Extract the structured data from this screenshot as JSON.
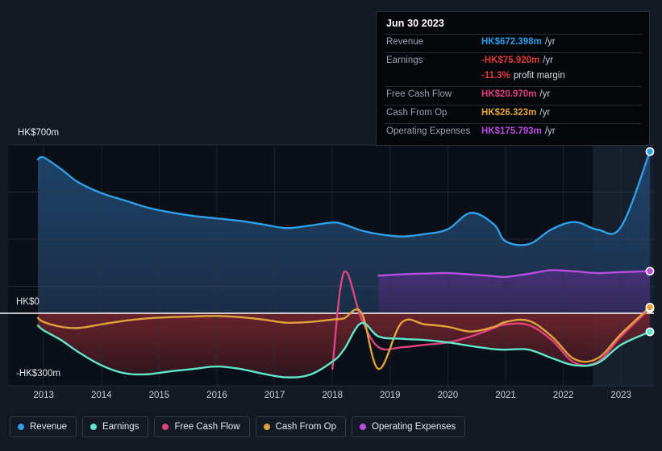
{
  "tooltip": {
    "date": "Jun 30 2023",
    "rows": [
      {
        "label": "Revenue",
        "value": "HK$672.398m",
        "unit": "/yr",
        "color": "#2f9fe8"
      },
      {
        "label": "Earnings",
        "value": "-HK$75.920m",
        "unit": "/yr",
        "color": "#e03c3c"
      },
      {
        "label": "",
        "value": "-11.3%",
        "unit": "profit margin",
        "color": "#e03c3c"
      },
      {
        "label": "Free Cash Flow",
        "value": "HK$20.970m",
        "unit": "/yr",
        "color": "#e0427d"
      },
      {
        "label": "Cash From Op",
        "value": "HK$26.323m",
        "unit": "/yr",
        "color": "#e0a33c"
      },
      {
        "label": "Operating Expenses",
        "value": "HK$175.793m",
        "unit": "/yr",
        "color": "#b84de0"
      }
    ]
  },
  "legend": {
    "items": [
      {
        "label": "Revenue",
        "color": "#2f9fe8"
      },
      {
        "label": "Earnings",
        "color": "#5ee8c8"
      },
      {
        "label": "Free Cash Flow",
        "color": "#e0427d"
      },
      {
        "label": "Cash From Op",
        "color": "#e0a33c"
      },
      {
        "label": "Operating Expenses",
        "color": "#b84de0"
      }
    ]
  },
  "axes": {
    "y_top_label": "HK$700m",
    "y_zero_label": "HK$0",
    "y_bottom_label": "-HK$300m",
    "x_ticks": [
      "2013",
      "2014",
      "2015",
      "2016",
      "2017",
      "2018",
      "2019",
      "2020",
      "2021",
      "2022",
      "2023"
    ]
  },
  "chart_data": {
    "type": "area",
    "title": "",
    "xlabel": "",
    "ylabel": "HK$",
    "ylim": [
      -300,
      700
    ],
    "grid": true,
    "legend_position": "bottom-left",
    "currency": "HKD",
    "units": "millions",
    "x": [
      2012.9,
      2013.0,
      2013.3,
      2013.6,
      2014.0,
      2014.4,
      2014.8,
      2015.2,
      2015.6,
      2016.0,
      2016.4,
      2016.8,
      2017.2,
      2017.6,
      2018.0,
      2018.2,
      2018.5,
      2018.8,
      2019.2,
      2019.6,
      2020.0,
      2020.4,
      2020.8,
      2021.0,
      2021.4,
      2021.8,
      2022.2,
      2022.6,
      2023.0,
      2023.5
    ],
    "series": [
      {
        "name": "Revenue",
        "color": "#2f9fe8",
        "values": [
          640,
          648,
          600,
          545,
          500,
          470,
          440,
          420,
          405,
          395,
          385,
          370,
          355,
          365,
          378,
          370,
          345,
          330,
          320,
          330,
          350,
          418,
          370,
          300,
          288,
          350,
          380,
          348,
          360,
          672.398
        ],
        "end_value": 672.398
      },
      {
        "name": "Earnings",
        "color": "#5ee8c8",
        "values": [
          -50,
          -70,
          -110,
          -160,
          -215,
          -248,
          -252,
          -240,
          -230,
          -220,
          -230,
          -250,
          -265,
          -255,
          -200,
          -150,
          -40,
          -95,
          -105,
          -110,
          -120,
          -135,
          -148,
          -150,
          -150,
          -185,
          -215,
          -205,
          -130,
          -75.92
        ],
        "end_value": -75.92
      },
      {
        "name": "Free Cash Flow",
        "color": "#e0427d",
        "values": [
          null,
          null,
          null,
          null,
          null,
          null,
          null,
          null,
          null,
          null,
          null,
          null,
          null,
          null,
          -230,
          170,
          -20,
          -140,
          -140,
          -130,
          -120,
          -95,
          -60,
          -45,
          -48,
          -110,
          -205,
          -200,
          -95,
          20.97
        ],
        "end_value": 20.97
      },
      {
        "name": "Cash From Op",
        "color": "#e0a33c",
        "values": [
          -18,
          -35,
          -55,
          -60,
          -45,
          -30,
          -20,
          -15,
          -12,
          -10,
          -15,
          -25,
          -38,
          -35,
          -25,
          -20,
          5,
          -230,
          -38,
          -45,
          -55,
          -75,
          -55,
          -35,
          -30,
          -95,
          -190,
          -185,
          -85,
          26.323
        ],
        "end_value": 26.323
      },
      {
        "name": "Operating Expenses",
        "color": "#b84de0",
        "values": [
          null,
          null,
          null,
          null,
          null,
          null,
          null,
          null,
          null,
          null,
          null,
          null,
          null,
          null,
          null,
          null,
          null,
          157,
          163,
          166,
          168,
          162,
          155,
          152,
          165,
          180,
          175,
          168,
          172,
          175.793
        ],
        "end_value": 175.793
      }
    ]
  },
  "colors": {
    "page_bg": "#141a24",
    "plot_bg": "#0b0f17",
    "revenue_fill": "#1d3350",
    "negative_fill": "#4a2128",
    "opex_fill": "#3c2d63",
    "gridline": "#3a4252",
    "zero_line": "#ffffff",
    "highlight_band": "#18222f"
  }
}
